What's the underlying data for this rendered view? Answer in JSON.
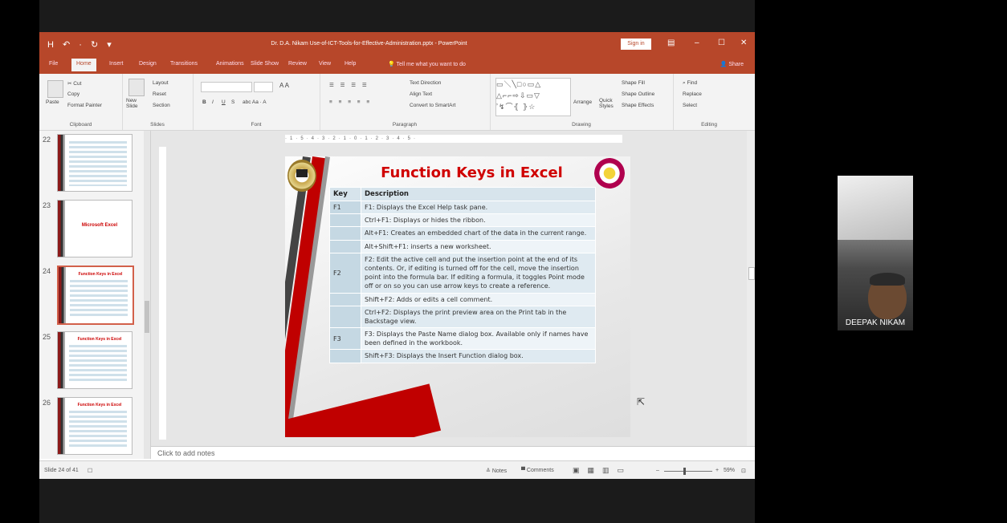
{
  "window": {
    "quick_access": "H ↶ · ↻ ▾",
    "title": "Dr. D.A. Nikam Use-of-ICT-Tools-for-Effective-Administration.pptx - PowerPoint",
    "sign_in": "Sign in",
    "min": "–",
    "max": "☐",
    "close": "✕"
  },
  "tabs": [
    "File",
    "Home",
    "Insert",
    "Design",
    "Transitions",
    "Animations",
    "Slide Show",
    "Review",
    "View",
    "Help"
  ],
  "tell_me": "Tell me what you want to do",
  "share": "Share",
  "ribbon": {
    "clipboard": {
      "paste": "Paste",
      "cut": "Cut",
      "copy": "Copy",
      "format_painter": "Format Painter",
      "label": "Clipboard"
    },
    "slides": {
      "new_slide": "New Slide",
      "layout": "Layout",
      "reset": "Reset",
      "section": "Section",
      "label": "Slides"
    },
    "font": {
      "bold": "B",
      "italic": "I",
      "underline": "U",
      "strike": "S",
      "label": "Font"
    },
    "paragraph": {
      "text_direction": "Text Direction",
      "align_text": "Align Text",
      "convert": "Convert to SmartArt",
      "label": "Paragraph"
    },
    "drawing": {
      "arrange": "Arrange",
      "quick_styles": "Quick Styles",
      "shape_fill": "Shape Fill",
      "shape_outline": "Shape Outline",
      "shape_effects": "Shape Effects",
      "label": "Drawing"
    },
    "editing": {
      "find": "Find",
      "replace": "Replace",
      "select": "Select",
      "label": "Editing"
    }
  },
  "thumbnails": [
    {
      "num": "22",
      "title": ""
    },
    {
      "num": "23",
      "title": "Microsoft Excel"
    },
    {
      "num": "24",
      "title": "Function Keys in Excel"
    },
    {
      "num": "25",
      "title": "Function Keys in Excel"
    },
    {
      "num": "26",
      "title": "Function Keys in Excel"
    }
  ],
  "slide": {
    "title": "Function Keys in Excel",
    "col_key": "Key",
    "col_desc": "Description",
    "rows": [
      {
        "key": "F1",
        "desc": "F1: Displays the Excel Help task pane."
      },
      {
        "key": "",
        "desc": "Ctrl+F1: Displays or hides the ribbon."
      },
      {
        "key": "",
        "desc": "Alt+F1: Creates an embedded chart of the data in the current range."
      },
      {
        "key": "",
        "desc": "Alt+Shift+F1: inserts a new worksheet."
      },
      {
        "key": "F2",
        "desc": "F2: Edit the active cell and put the insertion point at the end of its contents. Or, if editing is turned off for the cell, move the insertion point into the formula bar. If editing a formula, it toggles Point mode off or on so you can use arrow keys to create a reference."
      },
      {
        "key": "",
        "desc": "Shift+F2: Adds or edits a cell comment."
      },
      {
        "key": "",
        "desc": "Ctrl+F2: Displays the print preview area on the Print tab in the Backstage view."
      },
      {
        "key": "F3",
        "desc": "F3: Displays the Paste Name dialog box. Available only if names have been defined in the workbook."
      },
      {
        "key": "",
        "desc": "Shift+F3: Displays the Insert Function dialog box."
      }
    ]
  },
  "notes_placeholder": "Click to add notes",
  "status": {
    "slide_count": "Slide 24 of 41",
    "notes": "Notes",
    "comments": "Comments",
    "zoom": "59%"
  },
  "zoom_level": 0.4,
  "participant": {
    "name": "DEEPAK NIKAM"
  },
  "colors": {
    "ppt_accent": "#b7472a",
    "slide_title": "#d00000",
    "table_header": "#d7e4ec"
  }
}
